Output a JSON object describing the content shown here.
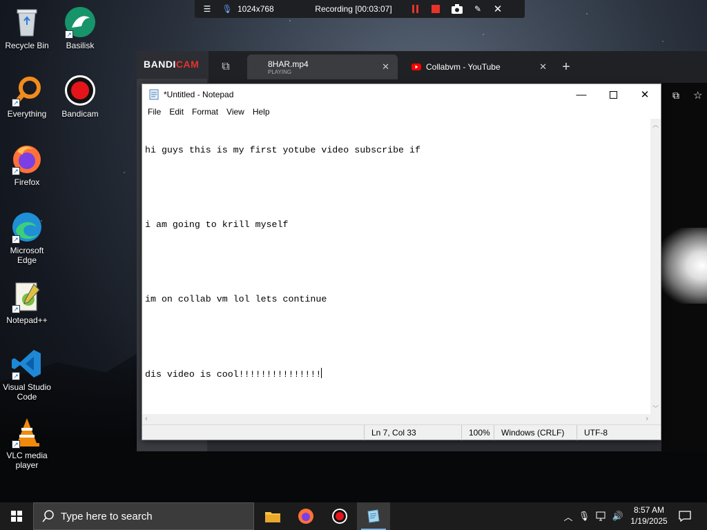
{
  "desktop": {
    "icons": [
      {
        "label": "Recycle Bin",
        "icon": "recycle-bin-icon"
      },
      {
        "label": "Basilisk",
        "icon": "basilisk-icon"
      },
      {
        "label": "Everything",
        "icon": "everything-search-icon"
      },
      {
        "label": "Bandicam",
        "icon": "bandicam-record-icon"
      },
      {
        "label": "Firefox",
        "icon": "firefox-icon"
      },
      {
        "label": "Microsoft Edge",
        "icon": "edge-icon"
      },
      {
        "label": "Notepad++",
        "icon": "notepad-plus-plus-icon"
      },
      {
        "label": "Visual Studio Code",
        "icon": "vscode-icon"
      },
      {
        "label": "VLC media player",
        "icon": "vlc-icon"
      }
    ]
  },
  "recording_bar": {
    "resolution": "1024x768",
    "status": "Recording [00:03:07]"
  },
  "bandicam": {
    "logo_prefix": "BANDI",
    "logo_suffix": "CAM",
    "tabs": [
      {
        "title": "8HAR.mp4",
        "subtitle": "PLAYING"
      },
      {
        "title": "Collabvm - YouTube"
      }
    ]
  },
  "notepad": {
    "title": "*Untitled - Notepad",
    "menu": [
      "File",
      "Edit",
      "Format",
      "View",
      "Help"
    ],
    "lines": [
      "hi guys this is my first yotube video subscribe if",
      "",
      "i am going to krill myself",
      "",
      "im on collab vm lol lets continue",
      "",
      "dis video is cool!!!!!!!!!!!!!!!"
    ],
    "status": {
      "position": "Ln 7, Col 33",
      "zoom": "100%",
      "line_ending": "Windows (CRLF)",
      "encoding": "UTF-8"
    }
  },
  "taskbar": {
    "search_placeholder": "Type here to search",
    "time": "8:57 AM",
    "date": "1/19/2025"
  },
  "colors": {
    "accent_red": "#e7332b",
    "taskbar_bg": "#1c1c1c",
    "youtube_red": "#ff0000"
  }
}
